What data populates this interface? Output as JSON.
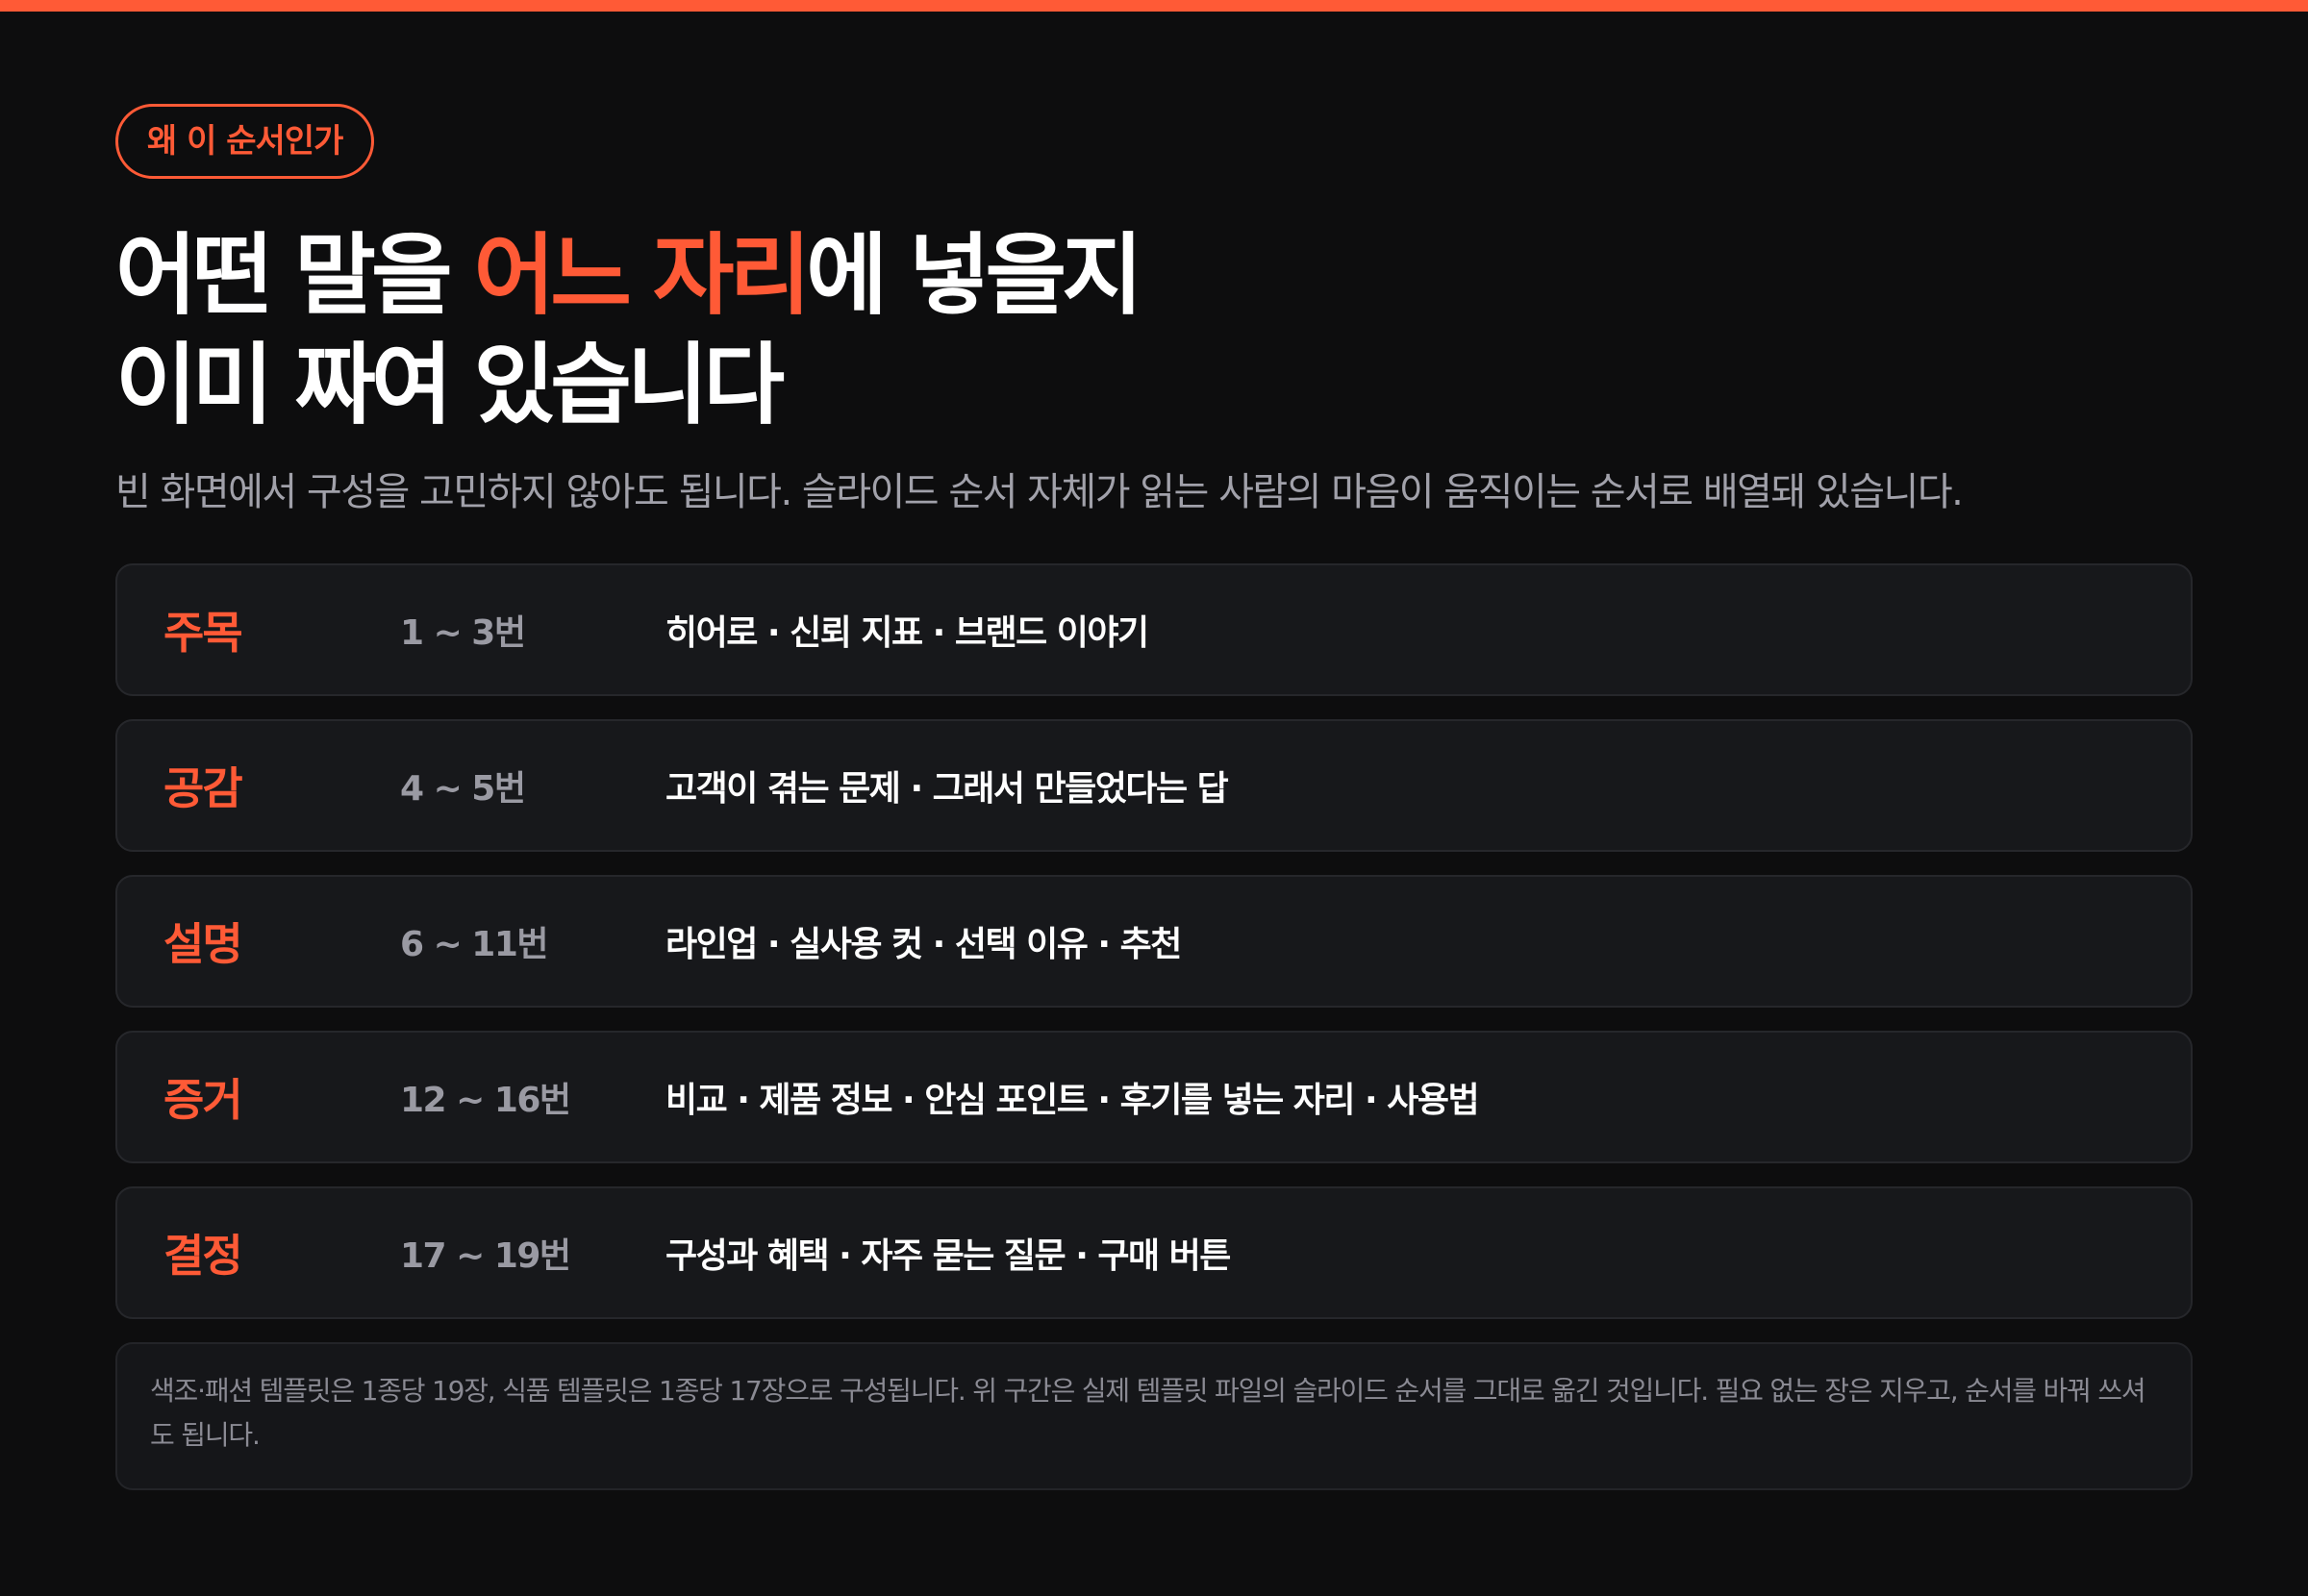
{
  "badge": "왜 이 순서인가",
  "title": {
    "line1_before": "어떤 말을 ",
    "line1_accent": "어느 자리",
    "line1_after": "에 넣을지",
    "line2": "이미 짜여 있습니다"
  },
  "subtitle": "빈 화면에서 구성을 고민하지 않아도 됩니다. 슬라이드 순서 자체가 읽는 사람의 마음이 움직이는 순서로 배열돼 있습니다.",
  "rows": [
    {
      "label": "주목",
      "range": "1 ~ 3번",
      "desc": "히어로 · 신뢰 지표 · 브랜드 이야기"
    },
    {
      "label": "공감",
      "range": "4 ~ 5번",
      "desc": "고객이 겪는 문제 · 그래서 만들었다는 답"
    },
    {
      "label": "설명",
      "range": "6 ~ 11번",
      "desc": "라인업 · 실사용 컷 · 선택 이유 · 추천"
    },
    {
      "label": "증거",
      "range": "12 ~ 16번",
      "desc": "비교 · 제품 정보 · 안심 포인트 · 후기를 넣는 자리 · 사용법"
    },
    {
      "label": "결정",
      "range": "17 ~ 19번",
      "desc": "구성과 혜택 · 자주 묻는 질문 · 구매 버튼"
    }
  ],
  "note": "색조·패션 템플릿은 1종당 19장, 식품 템플릿은 1종당 17장으로 구성됩니다. 위 구간은 실제 템플릿 파일의 슬라이드 순서를 그대로 옮긴 것입니다. 필요 없는 장은 지우고, 순서를 바꿔 쓰셔도 됩니다.",
  "colors": {
    "accent": "#ff5a36",
    "background": "#0d0d0e",
    "card": "#17181b"
  }
}
